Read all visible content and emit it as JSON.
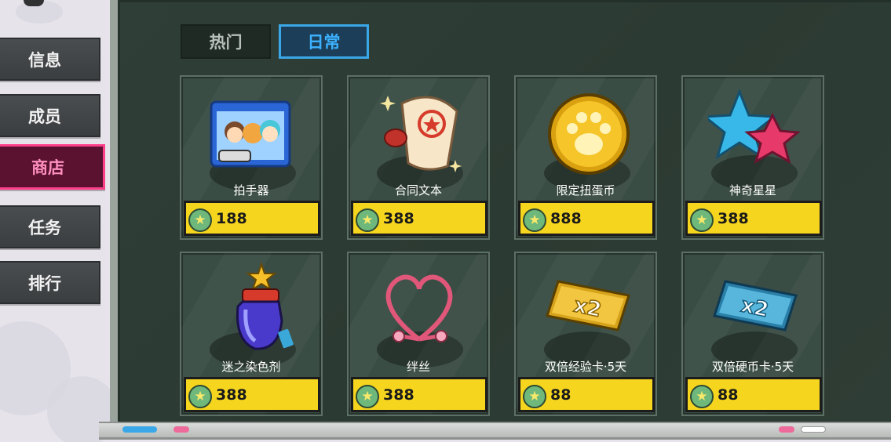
{
  "menu": {
    "items": [
      {
        "label": "信息",
        "active": false
      },
      {
        "label": "成员",
        "active": false
      },
      {
        "label": "商店",
        "active": true
      },
      {
        "label": "任务",
        "active": false
      },
      {
        "label": "排行",
        "active": false
      }
    ]
  },
  "tabs": [
    {
      "label": "热门",
      "active": false
    },
    {
      "label": "日常",
      "active": true
    }
  ],
  "shop": {
    "items": [
      {
        "name": "拍手器",
        "price": "188",
        "icon": "clapper-box-icon"
      },
      {
        "name": "合同文本",
        "price": "388",
        "icon": "contract-scroll-icon"
      },
      {
        "name": "限定扭蛋币",
        "price": "888",
        "icon": "paw-coin-icon"
      },
      {
        "name": "神奇星星",
        "price": "388",
        "icon": "magic-stars-icon"
      },
      {
        "name": "迷之染色剂",
        "price": "388",
        "icon": "dye-bottle-icon"
      },
      {
        "name": "绊丝",
        "price": "388",
        "icon": "heart-string-icon"
      },
      {
        "name": "双倍经验卡·5天",
        "price": "88",
        "icon": "double-exp-card-icon"
      },
      {
        "name": "双倍硬币卡·5天",
        "price": "88",
        "icon": "double-coin-card-icon"
      }
    ],
    "currency_icon": "star-coin-icon"
  },
  "colors": {
    "board": "#2f3f37",
    "price_bar": "#f6d51e",
    "active_menu": "#ff3e8a",
    "active_tab": "#3aa8e8"
  }
}
